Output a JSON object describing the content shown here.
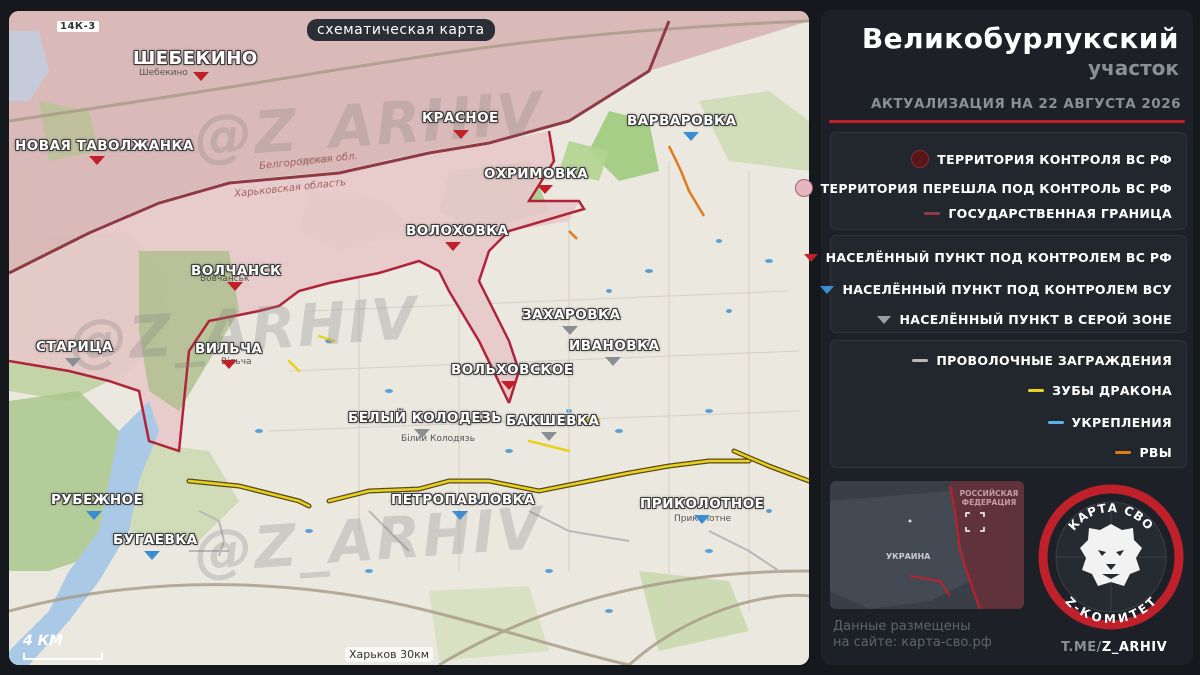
{
  "map": {
    "chip": "схематическая карта",
    "road": "14К-3",
    "watermark": "@Z_ARHIV",
    "scale": "4 КМ",
    "kharkov": "Харьков 30км",
    "small_labels": {
      "shebekino": "Шебекино",
      "volchansk": "Вовчанськ",
      "vilcha": "Вільча",
      "bely": "Білий Колодязь",
      "prikol": "Приколотне",
      "oblast1": "Белгородская обл.",
      "oblast2": "Харьковская область"
    },
    "places": {
      "shebekino": "ШЕБЕКИНО",
      "nov_tavolzhanka": "НОВАЯ ТАВОЛЖАНКА",
      "krasnoe": "КРАСНОЕ",
      "varvarovka": "ВАРВАРОВКА",
      "okhrimovka": "ОХРИМОВКА",
      "volokhovka": "ВОЛОХОВКА",
      "volchansk": "ВОЛЧАНСК",
      "zakharovka": "ЗАХАРОВКА",
      "ivanovka": "ИВАНОВКА",
      "staritsa": "СТАРИЦА",
      "vilcha": "ВИЛЬЧА",
      "volkhovskoe": "ВОЛЬХОВСКОЕ",
      "bely_kolodez": "БЕЛЫЙ КОЛОДЕЗЬ",
      "bakshevka": "БАКШЕВКА",
      "rubezhnoe": "РУБЕЖНОЕ",
      "petropavlovka": "ПЕТРОПАВЛОВКА",
      "prikolotnoe": "ПРИКОЛОТНОЕ",
      "bugaevka": "БУГАЕВКА"
    }
  },
  "panel": {
    "title": "Великобурлукский",
    "subtitle": "участок",
    "actualization": "АКТУАЛИЗАЦИЯ НА 22 АВГУСТА 2026",
    "legend_territory": [
      {
        "label": "ТЕРРИТОРИЯ КОНТРОЛЯ ВС РФ",
        "color": "#6b1a1f"
      },
      {
        "label": "ТЕРРИТОРИЯ ПЕРЕШЛА ПОД КОНТРОЛЬ ВС РФ",
        "color": "#e6b5bd"
      },
      {
        "label": "ГОСУДАРСТВЕННАЯ ГРАНИЦА",
        "color": "#8f3a44"
      }
    ],
    "legend_settlements": [
      {
        "label": "НАСЕЛЁННЫЙ ПУНКТ ПОД КОНТРОЛЕМ ВС РФ",
        "color": "#c0202a"
      },
      {
        "label": "НАСЕЛЁННЫЙ ПУНКТ ПОД КОНТРОЛЕМ ВСУ",
        "color": "#3a8ed0"
      },
      {
        "label": "НАСЕЛЁННЫЙ ПУНКТ В СЕРОЙ ЗОНЕ",
        "color": "#9a9ea4"
      }
    ],
    "legend_fortifications": [
      {
        "label": "ПРОВОЛОЧНЫЕ ЗАГРАЖДЕНИЯ",
        "color": "#b8b8b8"
      },
      {
        "label": "ЗУБЫ ДРАКОНА",
        "color": "#e8d21e"
      },
      {
        "label": "УКРЕПЛЕНИЯ",
        "color": "#5ab0e8"
      },
      {
        "label": "РВЫ",
        "color": "#e07a1a"
      }
    ],
    "minimap": {
      "russia": "РОССИЙСКАЯ ФЕДЕРАЦИЯ",
      "ukraine": "УКРАИНА"
    },
    "site_line1": "Данные размещены",
    "site_line2": "на сайте: карта-сво.рф",
    "tme_prefix": "T.ME/",
    "tme_handle": "Z_ARHIV",
    "logo_top": "КАРТА СВО",
    "logo_bottom": "Z-КОМИТЕТ"
  }
}
